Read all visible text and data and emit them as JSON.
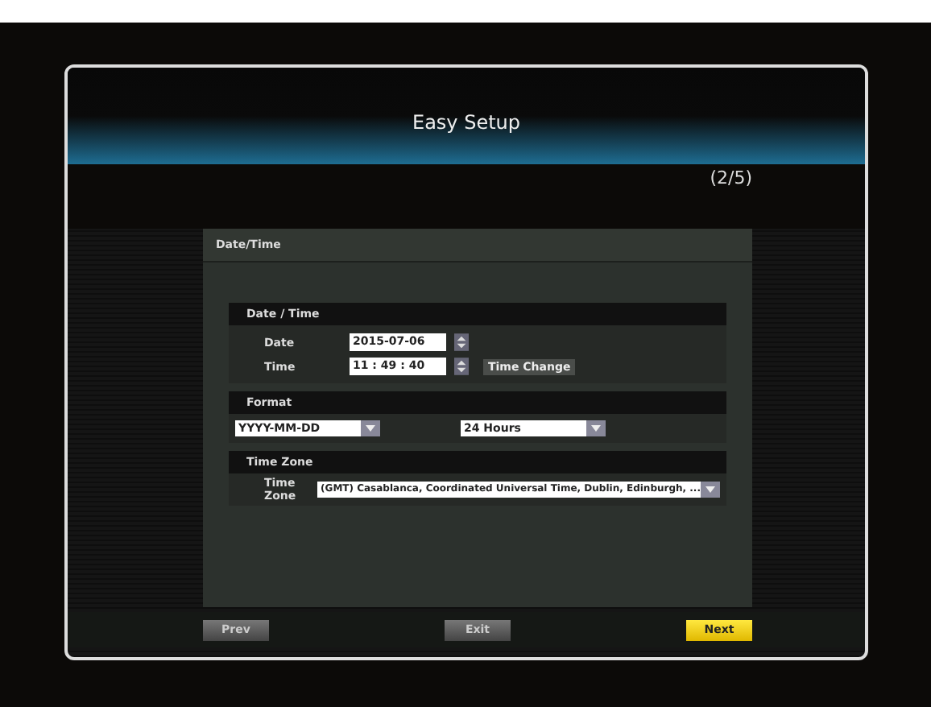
{
  "dialog": {
    "title": "Easy Setup",
    "step": "(2/5)"
  },
  "panel": {
    "title": "Date/Time",
    "groups": [
      {
        "kind": "datetime",
        "title": "Date / Time",
        "fields": [
          {
            "label": "Date",
            "value": "2015-07-06"
          },
          {
            "label": "Time",
            "value": "11 : 49 : 40"
          }
        ],
        "action": "Time Change"
      },
      {
        "kind": "format",
        "title": "Format",
        "selects": [
          {
            "value": "YYYY-MM-DD"
          },
          {
            "value": "24 Hours"
          }
        ]
      },
      {
        "kind": "timezone",
        "title": "Time Zone",
        "label": "Time Zone",
        "value": "(GMT) Casablanca, Coordinated Universal Time, Dublin, Edinburgh, ..."
      }
    ]
  },
  "buttons": [
    {
      "label": "Prev",
      "selected": false
    },
    {
      "label": "Exit",
      "selected": false
    },
    {
      "label": "Next",
      "selected": true
    }
  ]
}
